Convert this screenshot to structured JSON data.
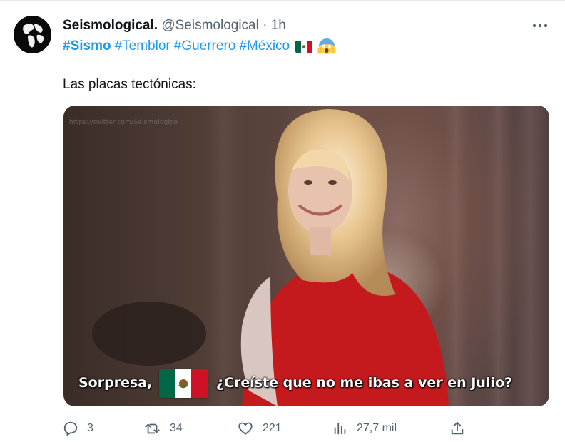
{
  "tweet": {
    "author_name": "Seismological.",
    "handle": "@Seismological",
    "separator": "·",
    "time": "1h",
    "hashtags": [
      "#Sismo",
      "#Temblor",
      "#Guerrero",
      "#México"
    ],
    "text": "Las placas tectónicas:",
    "media": {
      "watermark": "https://twitter.com/Seismologico",
      "caption_left": "Sorpresa,",
      "caption_right": "¿Creíste que no me ibas a ver en Julio?"
    },
    "stats": {
      "replies": "3",
      "retweets": "34",
      "likes": "221",
      "views": "27,7 mil"
    }
  },
  "colors": {
    "link": "#1d9bf0",
    "secondary_text": "#536471",
    "primary_text": "#0f1419",
    "flag_green": "#006847",
    "flag_red": "#ce1126"
  },
  "icons": [
    "globe-avatar-icon",
    "more-icon",
    "mexico-flag-icon",
    "screaming-face-icon",
    "reply-icon",
    "retweet-icon",
    "like-icon",
    "views-icon",
    "share-icon"
  ]
}
